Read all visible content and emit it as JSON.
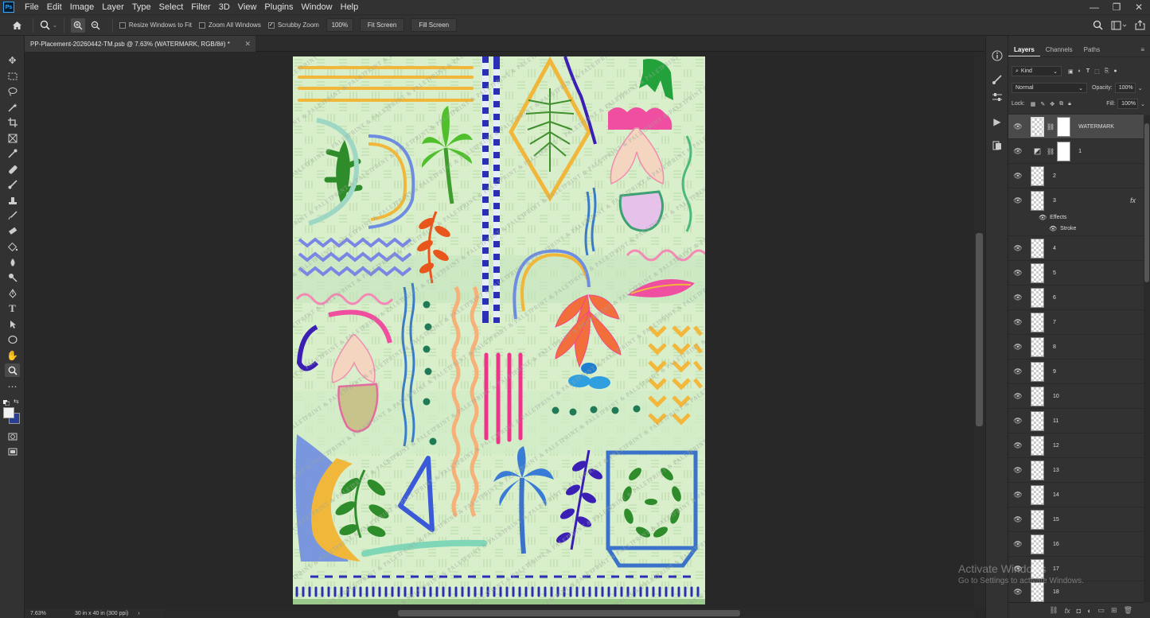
{
  "menubar": {
    "logo": "Ps",
    "items": [
      "File",
      "Edit",
      "Image",
      "Layer",
      "Type",
      "Select",
      "Filter",
      "3D",
      "View",
      "Plugins",
      "Window",
      "Help"
    ],
    "win_min": "—",
    "win_restore": "❐",
    "win_close": "✕"
  },
  "options": {
    "resize_windows": "Resize Windows to Fit",
    "zoom_all": "Zoom All Windows",
    "scrubby_zoom": "Scrubby Zoom",
    "zoom_value": "100%",
    "fit_screen": "Fit Screen",
    "fill_screen": "Fill Screen",
    "scrubby_checked": true
  },
  "document": {
    "tab_title": "PP-Placement-20260442-TM.psb @ 7.63% (WATERMARK, RGB/8#) *",
    "zoom": "7.63%",
    "size": "30 in x 40 in (300 ppi)",
    "watermark_text": "PRINT & PALETTE"
  },
  "layers_panel": {
    "tabs": [
      "Layers",
      "Channels",
      "Paths"
    ],
    "active_tab": "Layers",
    "filter_kind": "Kind",
    "blend_mode": "Normal",
    "opacity_label": "Opacity:",
    "opacity": "100%",
    "lock_label": "Lock:",
    "fill_label": "Fill:",
    "fill": "100%",
    "effects_label": "Effects",
    "stroke_label": "Stroke",
    "fx_label": "fx",
    "layers": [
      {
        "name": "WATERMARK",
        "selected": true
      },
      {
        "name": "1"
      },
      {
        "name": "2"
      },
      {
        "name": "3",
        "has_fx": true
      },
      {
        "name": "4"
      },
      {
        "name": "5"
      },
      {
        "name": "6"
      },
      {
        "name": "7"
      },
      {
        "name": "8"
      },
      {
        "name": "9"
      },
      {
        "name": "10"
      },
      {
        "name": "11"
      },
      {
        "name": "12"
      },
      {
        "name": "13"
      },
      {
        "name": "14"
      },
      {
        "name": "15"
      },
      {
        "name": "16"
      },
      {
        "name": "17"
      },
      {
        "name": "18"
      }
    ]
  },
  "windows_notice": {
    "title": "Activate Windows",
    "subtitle": "Go to Settings to activate Windows."
  },
  "colors": {
    "foreground": "#f2f2f2",
    "background": "#2a3f8f",
    "artboard_bg": "#d7edc9"
  }
}
